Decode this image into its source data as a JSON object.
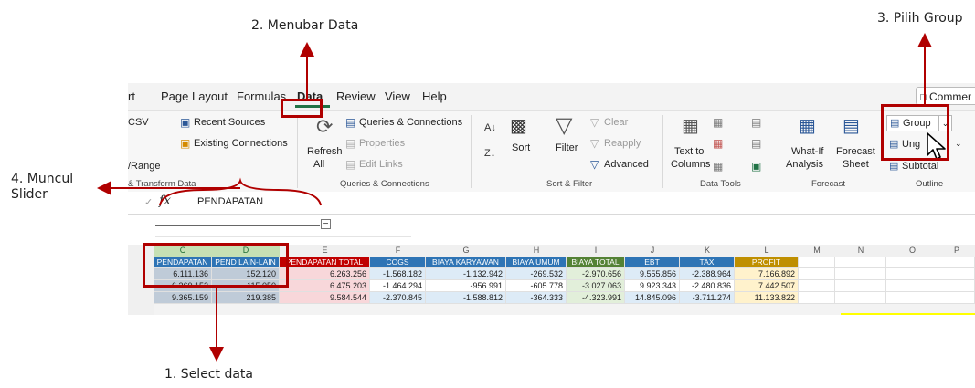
{
  "annotations": {
    "step1": "1. Select data",
    "step2": "2. Menubar Data",
    "step3": "3. Pilih Group",
    "step4": "4. Muncul Slider"
  },
  "menu": {
    "items": [
      "rt",
      "Page Layout",
      "Formulas",
      "Data",
      "Review",
      "View",
      "Help"
    ],
    "comments": "Commer"
  },
  "ribbon": {
    "get_data": {
      "csv": "CSV",
      "range": "/Range",
      "group": "& Transform Data"
    },
    "recent_sources": "Recent Sources",
    "existing_connections": "Existing Connections",
    "refresh_all": [
      "Refresh",
      "All"
    ],
    "queries_connections": "Queries & Connections",
    "properties": "Properties",
    "edit_links": "Edit Links",
    "group_queries": "Queries & Connections",
    "sort": "Sort",
    "filter": "Filter",
    "clear": "Clear",
    "reapply": "Reapply",
    "advanced": "Advanced",
    "group_sort": "Sort & Filter",
    "text_to_columns": [
      "Text to",
      "Columns"
    ],
    "group_tools": "Data Tools",
    "what_if": [
      "What-If",
      "Analysis"
    ],
    "forecast_sheet": [
      "Forecast",
      "Sheet"
    ],
    "group_forecast": "Forecast",
    "group_btn": "Group",
    "ungroup_btn": "Ung",
    "subtotal": "Subtotal",
    "group_outline": "Outline"
  },
  "formula_bar": {
    "fx": "fx",
    "value": "PENDAPATAN"
  },
  "sheet": {
    "columns": [
      "C",
      "D",
      "E",
      "F",
      "G",
      "H",
      "I",
      "J",
      "K",
      "L",
      "M",
      "N",
      "O",
      "P"
    ],
    "headers": [
      "PENDAPATAN",
      "PEND LAIN-LAIN",
      "PENDAPATAN TOTAL",
      "COGS",
      "BIAYA KARYAWAN",
      "BIAYA UMUM",
      "BIAYA TOTAL",
      "EBT",
      "TAX",
      "PROFIT"
    ],
    "rows": [
      [
        "6.111.136",
        "152.120",
        "6.263.256",
        "-1.568.182",
        "-1.132.942",
        "-269.532",
        "-2.970.656",
        "9.555.856",
        "-2.388.964",
        "7.166.892"
      ],
      [
        "6.360.153",
        "115.050",
        "6.475.203",
        "-1.464.294",
        "-956.991",
        "-605.778",
        "-3.027.063",
        "9.923.343",
        "-2.480.836",
        "7.442.507"
      ],
      [
        "9.365.159",
        "219.385",
        "9.584.544",
        "-2.370.845",
        "-1.588.812",
        "-364.333",
        "-4.323.991",
        "14.845.096",
        "-3.711.274",
        "11.133.822"
      ]
    ]
  },
  "colors": {
    "accent_red": "#b00000",
    "header_blue": "#2e74b5",
    "header_red": "#c00000",
    "header_green": "#548235",
    "header_gold": "#bf8f00",
    "highlight_yellow": "#ffff00"
  }
}
